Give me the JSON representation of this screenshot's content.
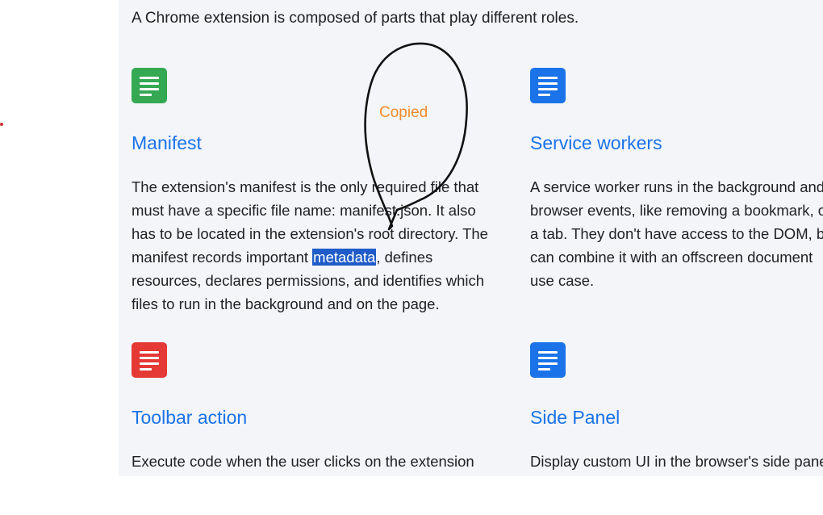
{
  "intro_text": "A Chrome extension is composed of parts that play different roles.",
  "copied_label": "Copied",
  "colors": {
    "accent_blue": "#1a73e8",
    "icon_green": "#34a853",
    "icon_blue": "#1a73e8",
    "icon_red": "#e53935",
    "copied_orange": "#f28c28",
    "selection_blue": "#1f5cc9",
    "stray_dot_red": "#d32f2f"
  },
  "cards": [
    {
      "icon": "document-icon",
      "title": "Manifest",
      "body_lines": [
        "The extension's manifest is the only required file that",
        "must have a specific file name: manifest.json. It also",
        "has to be located in the extension's root directory. The"
      ],
      "line4_before": "manifest records important ",
      "line4_selected": "metadata",
      "line4_after": ", defines",
      "body_lines_end": [
        "resources, declares permissions, and identifies which",
        "files to run in the background and on the page."
      ]
    },
    {
      "icon": "document-icon",
      "title": "Service workers",
      "body_lines": [
        "A service worker runs in the background and",
        "browser events, like removing a bookmark, or",
        "a tab. They don't have access to the DOM, but",
        "can combine it with an offscreen document",
        "use case."
      ]
    },
    {
      "icon": "document-icon",
      "title": "Toolbar action",
      "body_lines": [
        "Execute code when the user clicks on the extension"
      ]
    },
    {
      "icon": "document-icon",
      "title": "Side Panel",
      "body_lines": [
        "Display custom UI in the browser's side panel"
      ]
    }
  ]
}
